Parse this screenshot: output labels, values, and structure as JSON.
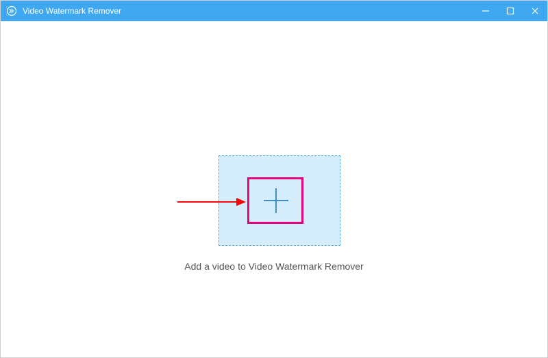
{
  "titlebar": {
    "app_name": "Video Watermark Remover"
  },
  "main": {
    "instruction": "Add a video to Video Watermark Remover"
  }
}
